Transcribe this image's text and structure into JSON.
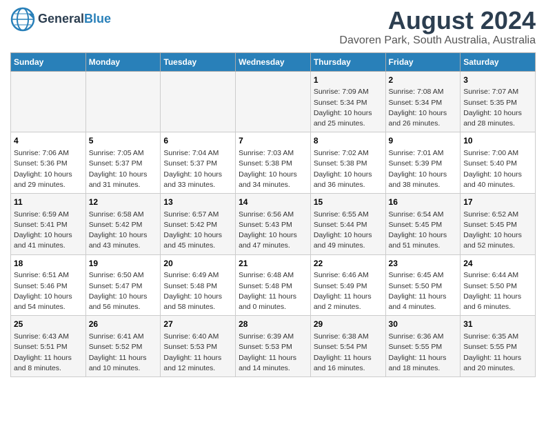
{
  "header": {
    "logo_line1": "General",
    "logo_line2": "Blue",
    "main_title": "August 2024",
    "subtitle": "Davoren Park, South Australia, Australia"
  },
  "weekdays": [
    "Sunday",
    "Monday",
    "Tuesday",
    "Wednesday",
    "Thursday",
    "Friday",
    "Saturday"
  ],
  "weeks": [
    [
      {
        "day": "",
        "info": ""
      },
      {
        "day": "",
        "info": ""
      },
      {
        "day": "",
        "info": ""
      },
      {
        "day": "",
        "info": ""
      },
      {
        "day": "1",
        "info": "Sunrise: 7:09 AM\nSunset: 5:34 PM\nDaylight: 10 hours\nand 25 minutes."
      },
      {
        "day": "2",
        "info": "Sunrise: 7:08 AM\nSunset: 5:34 PM\nDaylight: 10 hours\nand 26 minutes."
      },
      {
        "day": "3",
        "info": "Sunrise: 7:07 AM\nSunset: 5:35 PM\nDaylight: 10 hours\nand 28 minutes."
      }
    ],
    [
      {
        "day": "4",
        "info": "Sunrise: 7:06 AM\nSunset: 5:36 PM\nDaylight: 10 hours\nand 29 minutes."
      },
      {
        "day": "5",
        "info": "Sunrise: 7:05 AM\nSunset: 5:37 PM\nDaylight: 10 hours\nand 31 minutes."
      },
      {
        "day": "6",
        "info": "Sunrise: 7:04 AM\nSunset: 5:37 PM\nDaylight: 10 hours\nand 33 minutes."
      },
      {
        "day": "7",
        "info": "Sunrise: 7:03 AM\nSunset: 5:38 PM\nDaylight: 10 hours\nand 34 minutes."
      },
      {
        "day": "8",
        "info": "Sunrise: 7:02 AM\nSunset: 5:38 PM\nDaylight: 10 hours\nand 36 minutes."
      },
      {
        "day": "9",
        "info": "Sunrise: 7:01 AM\nSunset: 5:39 PM\nDaylight: 10 hours\nand 38 minutes."
      },
      {
        "day": "10",
        "info": "Sunrise: 7:00 AM\nSunset: 5:40 PM\nDaylight: 10 hours\nand 40 minutes."
      }
    ],
    [
      {
        "day": "11",
        "info": "Sunrise: 6:59 AM\nSunset: 5:41 PM\nDaylight: 10 hours\nand 41 minutes."
      },
      {
        "day": "12",
        "info": "Sunrise: 6:58 AM\nSunset: 5:42 PM\nDaylight: 10 hours\nand 43 minutes."
      },
      {
        "day": "13",
        "info": "Sunrise: 6:57 AM\nSunset: 5:42 PM\nDaylight: 10 hours\nand 45 minutes."
      },
      {
        "day": "14",
        "info": "Sunrise: 6:56 AM\nSunset: 5:43 PM\nDaylight: 10 hours\nand 47 minutes."
      },
      {
        "day": "15",
        "info": "Sunrise: 6:55 AM\nSunset: 5:44 PM\nDaylight: 10 hours\nand 49 minutes."
      },
      {
        "day": "16",
        "info": "Sunrise: 6:54 AM\nSunset: 5:45 PM\nDaylight: 10 hours\nand 51 minutes."
      },
      {
        "day": "17",
        "info": "Sunrise: 6:52 AM\nSunset: 5:45 PM\nDaylight: 10 hours\nand 52 minutes."
      }
    ],
    [
      {
        "day": "18",
        "info": "Sunrise: 6:51 AM\nSunset: 5:46 PM\nDaylight: 10 hours\nand 54 minutes."
      },
      {
        "day": "19",
        "info": "Sunrise: 6:50 AM\nSunset: 5:47 PM\nDaylight: 10 hours\nand 56 minutes."
      },
      {
        "day": "20",
        "info": "Sunrise: 6:49 AM\nSunset: 5:48 PM\nDaylight: 10 hours\nand 58 minutes."
      },
      {
        "day": "21",
        "info": "Sunrise: 6:48 AM\nSunset: 5:48 PM\nDaylight: 11 hours\nand 0 minutes."
      },
      {
        "day": "22",
        "info": "Sunrise: 6:46 AM\nSunset: 5:49 PM\nDaylight: 11 hours\nand 2 minutes."
      },
      {
        "day": "23",
        "info": "Sunrise: 6:45 AM\nSunset: 5:50 PM\nDaylight: 11 hours\nand 4 minutes."
      },
      {
        "day": "24",
        "info": "Sunrise: 6:44 AM\nSunset: 5:50 PM\nDaylight: 11 hours\nand 6 minutes."
      }
    ],
    [
      {
        "day": "25",
        "info": "Sunrise: 6:43 AM\nSunset: 5:51 PM\nDaylight: 11 hours\nand 8 minutes."
      },
      {
        "day": "26",
        "info": "Sunrise: 6:41 AM\nSunset: 5:52 PM\nDaylight: 11 hours\nand 10 minutes."
      },
      {
        "day": "27",
        "info": "Sunrise: 6:40 AM\nSunset: 5:53 PM\nDaylight: 11 hours\nand 12 minutes."
      },
      {
        "day": "28",
        "info": "Sunrise: 6:39 AM\nSunset: 5:53 PM\nDaylight: 11 hours\nand 14 minutes."
      },
      {
        "day": "29",
        "info": "Sunrise: 6:38 AM\nSunset: 5:54 PM\nDaylight: 11 hours\nand 16 minutes."
      },
      {
        "day": "30",
        "info": "Sunrise: 6:36 AM\nSunset: 5:55 PM\nDaylight: 11 hours\nand 18 minutes."
      },
      {
        "day": "31",
        "info": "Sunrise: 6:35 AM\nSunset: 5:55 PM\nDaylight: 11 hours\nand 20 minutes."
      }
    ]
  ]
}
